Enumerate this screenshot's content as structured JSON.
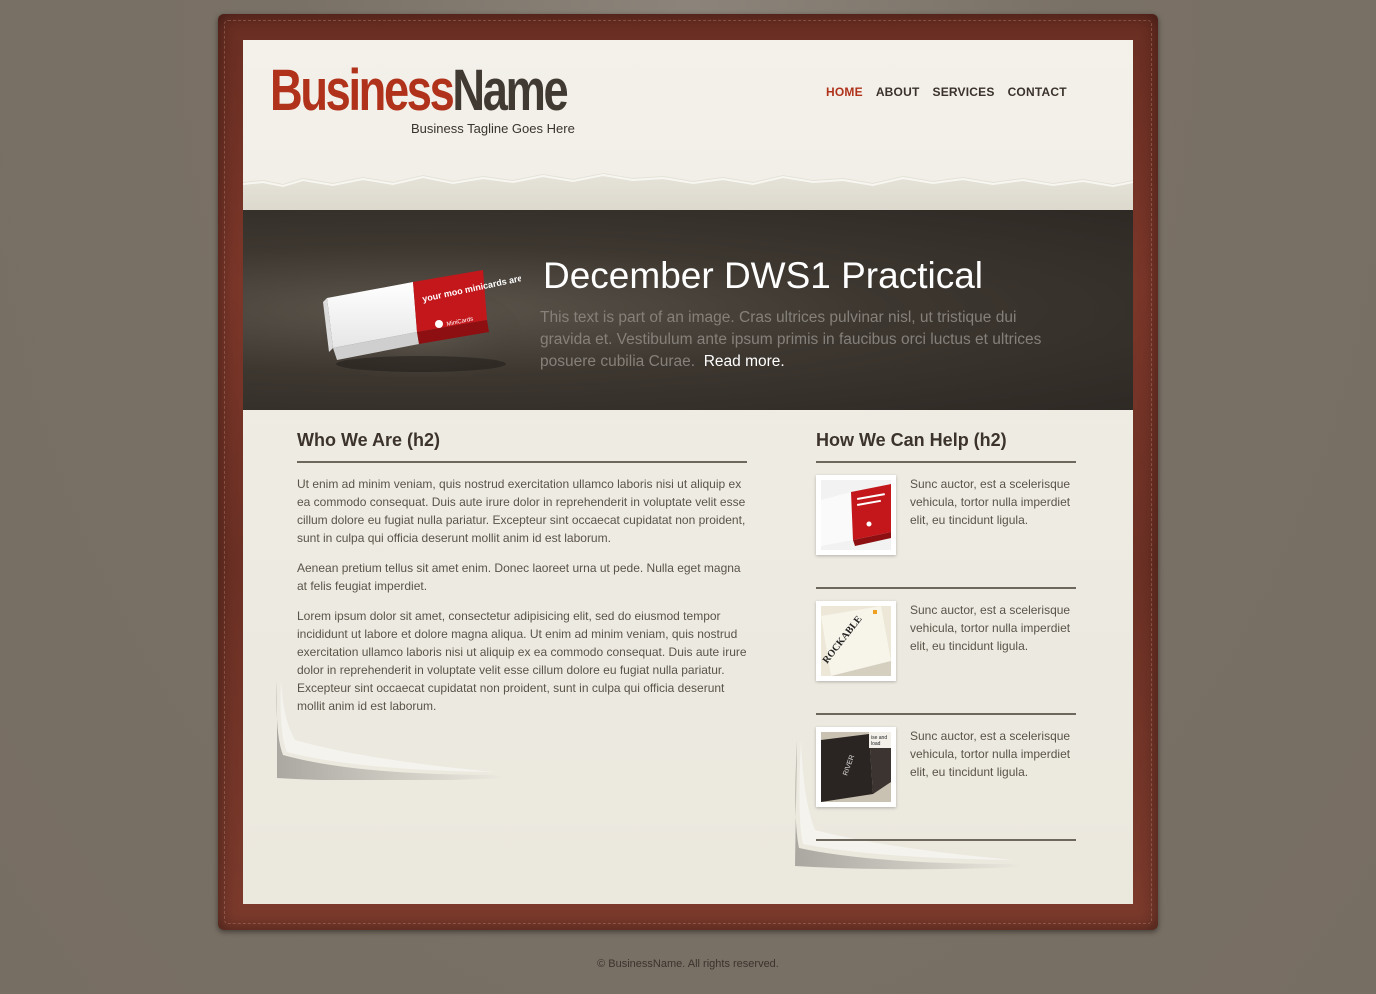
{
  "header": {
    "logo_part1": "Business",
    "logo_part2": "Name",
    "tagline": "Business Tagline Goes Here"
  },
  "nav": {
    "items": [
      {
        "label": "HOME",
        "active": true
      },
      {
        "label": "ABOUT",
        "active": false
      },
      {
        "label": "SERVICES",
        "active": false
      },
      {
        "label": "CONTACT",
        "active": false
      }
    ]
  },
  "banner": {
    "title": "December DWS1 Practical",
    "text": "This text is part of an image. Cras ultrices pulvinar nisl, ut tristique dui gravida et. Vestibulum ante ipsum primis in faucibus orci luctus et ultrices posuere cubilia Curae.",
    "read_more": "Read more.",
    "product_box_text": "your moo minicards are inside",
    "product_brand": "MiniCards"
  },
  "who_we_are": {
    "heading": "Who We Are (h2)",
    "paragraphs": [
      "Ut enim ad minim veniam, quis nostrud exercitation ullamco laboris nisi ut aliquip ex ea commodo consequat. Duis aute irure dolor in reprehenderit in voluptate velit esse cillum dolore eu fugiat nulla pariatur. Excepteur sint occaecat cupidatat non proident, sunt in culpa qui officia deserunt mollit anim id est laborum.",
      "Aenean pretium tellus sit amet enim. Donec laoreet urna ut pede. Nulla eget magna at felis feugiat imperdiet.",
      "Lorem ipsum dolor sit amet, consectetur adipisicing elit, sed do eiusmod tempor incididunt ut labore et dolore magna aliqua. Ut enim ad minim veniam, quis nostrud exercitation ullamco laboris nisi ut aliquip ex ea commodo consequat. Duis aute irure dolor in reprehenderit in voluptate velit esse cillum dolore eu fugiat nulla pariatur. Excepteur sint occaecat cupidatat non proident, sunt in culpa qui officia deserunt mollit anim id est laborum."
    ]
  },
  "how_we_help": {
    "heading": "How We Can Help (h2)",
    "items": [
      {
        "text": "Sunc auctor, est a scelerisque vehicula, tortor nulla imperdiet elit, eu tincidunt ligula.",
        "thumb": "minicards-box"
      },
      {
        "text": "Sunc auctor, est a scelerisque vehicula, tortor nulla imperdiet elit, eu tincidunt ligula.",
        "thumb": "rockable-card",
        "thumb_text": "ROCKABLE"
      },
      {
        "text": "Sunc auctor, est a scelerisque vehicula, tortor nulla imperdiet elit, eu tincidunt ligula.",
        "thumb": "black-brochure",
        "thumb_text_1": "ise and",
        "thumb_text_2": "load",
        "thumb_text_3": "RIVER"
      }
    ]
  },
  "footer": {
    "text": "© BusinessName. All rights reserved."
  },
  "colors": {
    "accent": "#b0321b",
    "dark_text": "#403a33",
    "page_bg": "#7a7166",
    "frame": "#6a2e22",
    "paper": "#efede4",
    "banner": "#3d3730"
  }
}
